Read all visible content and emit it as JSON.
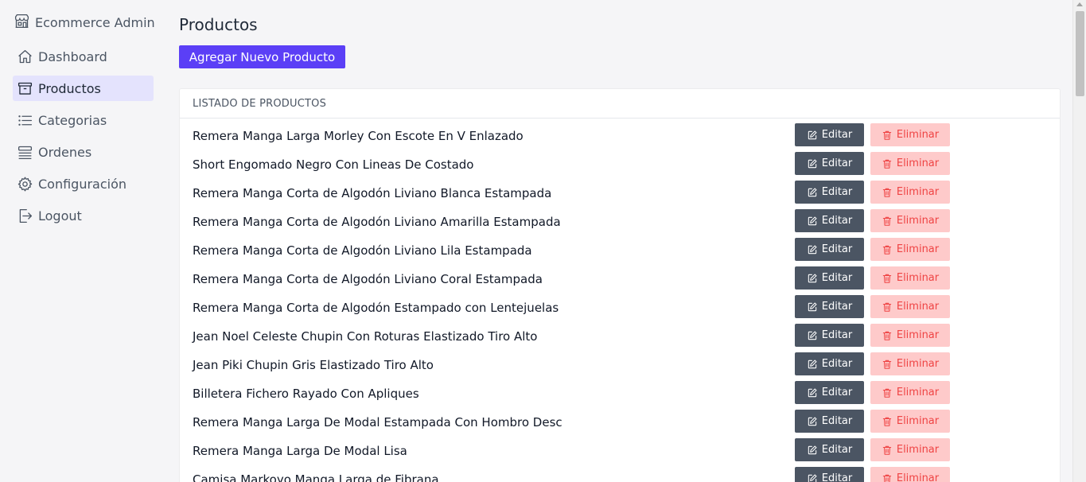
{
  "brand": {
    "name": "Ecommerce Admin",
    "icon": "store-icon"
  },
  "sidebar": {
    "items": [
      {
        "label": "Dashboard",
        "icon": "home-icon",
        "active": false
      },
      {
        "label": "Productos",
        "icon": "archive-box-icon",
        "active": true
      },
      {
        "label": "Categorias",
        "icon": "list-icon",
        "active": false
      },
      {
        "label": "Ordenes",
        "icon": "queue-list-icon",
        "active": false
      },
      {
        "label": "Configuración",
        "icon": "gear-icon",
        "active": false
      },
      {
        "label": "Logout",
        "icon": "logout-icon",
        "active": false
      }
    ]
  },
  "main": {
    "title": "Productos",
    "add_button": "Agregar Nuevo Producto",
    "list_header": "LISTADO DE PRODUCTOS",
    "edit_label": "Editar",
    "delete_label": "Eliminar",
    "products": [
      "Remera Manga Larga Morley Con Escote En V Enlazado",
      "Short Engomado Negro Con Lineas De Costado",
      "Remera Manga Corta de Algodón Liviano Blanca Estampada",
      "Remera Manga Corta de Algodón Liviano Amarilla Estampada",
      "Remera Manga Corta de Algodón Liviano Lila Estampada",
      "Remera Manga Corta de Algodón Liviano Coral Estampada",
      "Remera Manga Corta de Algodón Estampado con Lentejuelas",
      "Jean Noel Celeste Chupin Con Roturas Elastizado Tiro Alto",
      "Jean Piki Chupin Gris Elastizado Tiro Alto",
      "Billetera Fichero Rayado Con Apliques",
      "Remera Manga Larga De Modal Estampada Con Hombro Desc",
      "Remera Manga Larga De Modal Lisa",
      "Camisa Markoyo Manga Larga de Fibrana"
    ]
  },
  "colors": {
    "accent": "#5b3ff6",
    "active_nav_bg": "#e4e3fd",
    "edit_bg": "#4b5563",
    "delete_bg": "#fecaca",
    "delete_text": "#ef4444"
  }
}
